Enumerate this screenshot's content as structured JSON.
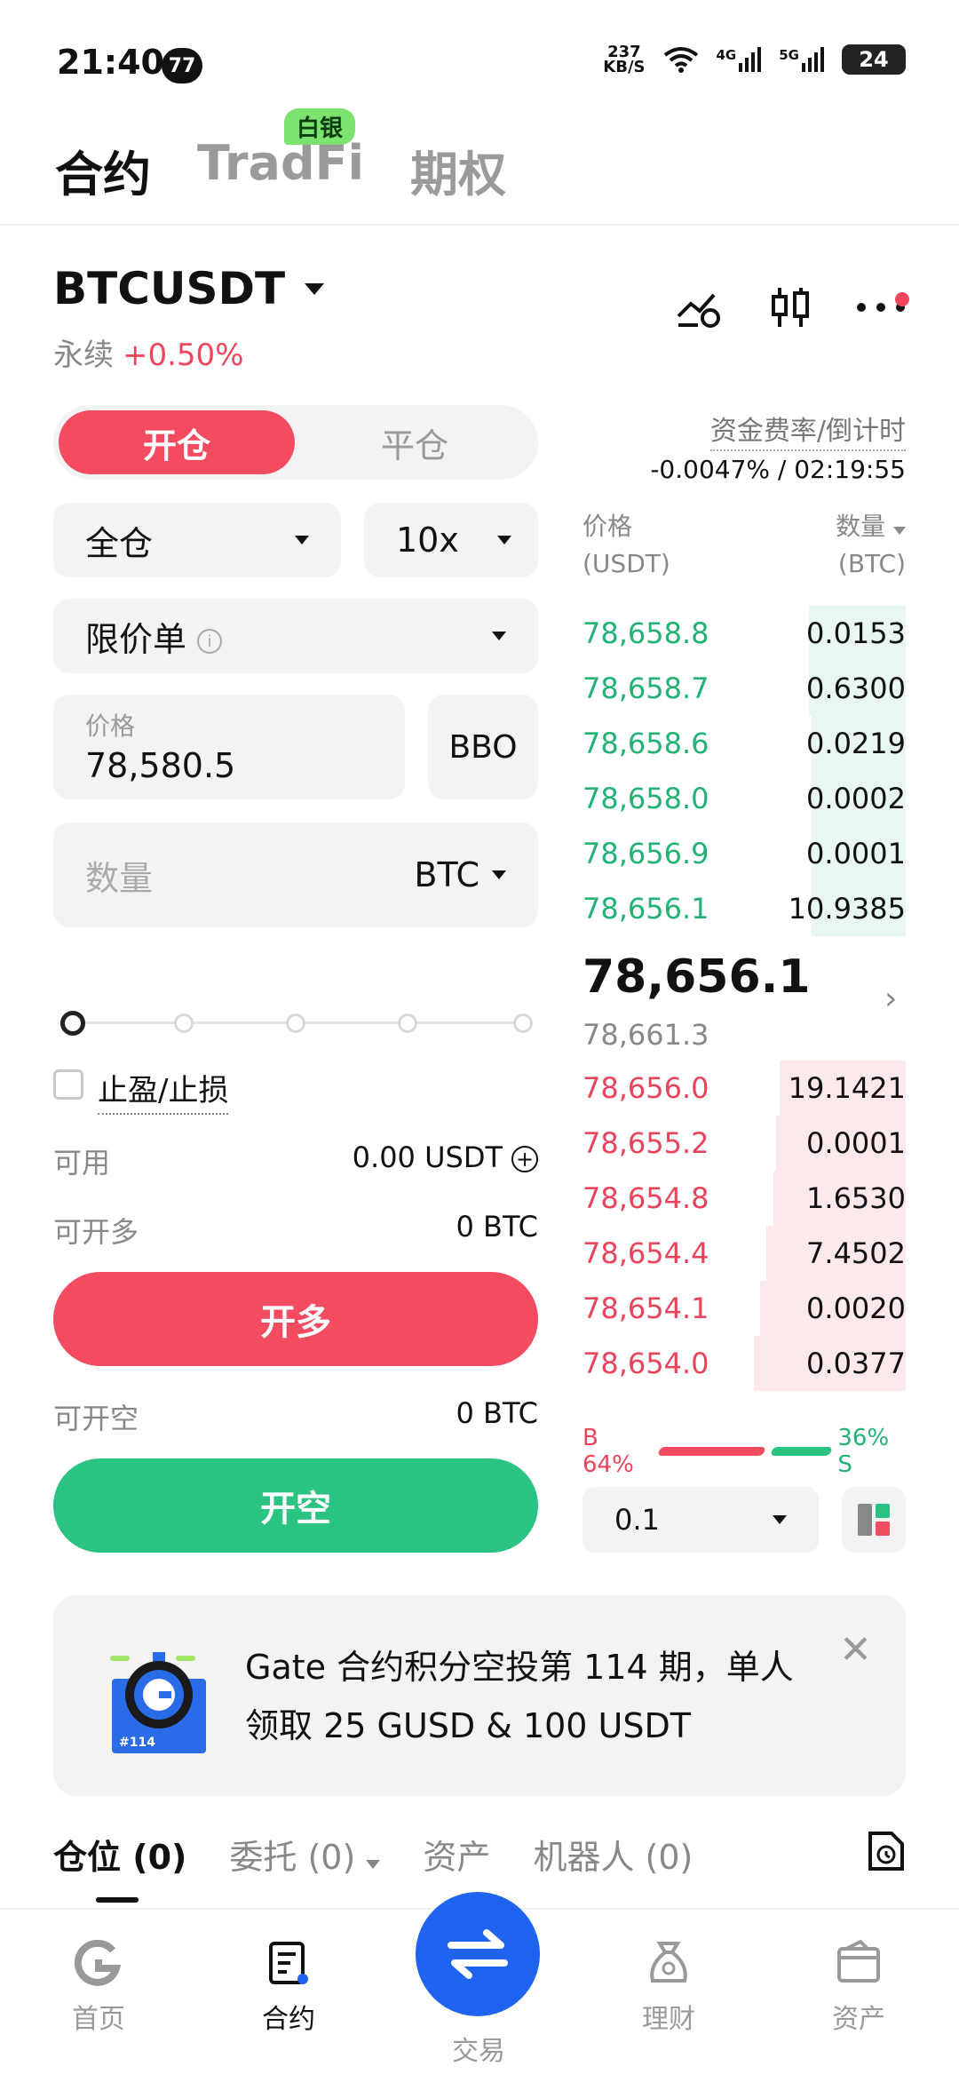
{
  "status_bar": {
    "time": "21:40",
    "badge": "77",
    "net_speed_value": "237",
    "net_speed_unit": "KB/S",
    "signal_1": "4G",
    "signal_2": "5G",
    "battery": "24"
  },
  "top_tabs": {
    "items": [
      "合约",
      "TradFi",
      "期权"
    ],
    "active": "合约",
    "tag": "白银"
  },
  "symbol": {
    "name": "BTCUSDT",
    "type": "永续",
    "change": "+0.50%"
  },
  "order_form": {
    "open_label": "开仓",
    "close_label": "平仓",
    "margin_mode": "全仓",
    "leverage": "10x",
    "order_type": "限价单",
    "price_label": "价格",
    "price_value": "78,580.5",
    "bbo_label": "BBO",
    "quantity_placeholder": "数量",
    "quantity_unit": "BTC",
    "slider_level": 0,
    "tp_sl_label": "止盈/止损",
    "available_label": "可用",
    "available_value": "0.00 USDT",
    "can_long_label": "可开多",
    "can_long_value": "0 BTC",
    "long_button": "开多",
    "can_short_label": "可开空",
    "can_short_value": "0 BTC",
    "short_button": "开空"
  },
  "orderbook": {
    "funding_label": "资金费率/倒计时",
    "funding_value": "-0.0047% / 02:19:55",
    "price_header": "价格",
    "price_unit": "(USDT)",
    "qty_header": "数量",
    "qty_unit": "(BTC)",
    "bids": [
      {
        "price": "78,658.8",
        "qty": "0.0153",
        "depth": 0.3
      },
      {
        "price": "78,658.7",
        "qty": "0.6300",
        "depth": 0.3
      },
      {
        "price": "78,658.6",
        "qty": "0.0219",
        "depth": 0.29
      },
      {
        "price": "78,658.0",
        "qty": "0.0002",
        "depth": 0.29
      },
      {
        "price": "78,656.9",
        "qty": "0.0001",
        "depth": 0.29
      },
      {
        "price": "78,656.1",
        "qty": "10.9385",
        "depth": 0.29
      }
    ],
    "last_price": "78,656.1",
    "mark_price": "78,661.3",
    "asks": [
      {
        "price": "78,656.0",
        "qty": "19.1421",
        "depth": 0.39
      },
      {
        "price": "78,655.2",
        "qty": "0.0001",
        "depth": 0.4
      },
      {
        "price": "78,654.8",
        "qty": "1.6530",
        "depth": 0.41
      },
      {
        "price": "78,654.4",
        "qty": "7.4502",
        "depth": 0.43
      },
      {
        "price": "78,654.1",
        "qty": "0.0020",
        "depth": 0.45
      },
      {
        "price": "78,654.0",
        "qty": "0.0377",
        "depth": 0.47
      }
    ],
    "buy_ratio": "B 64%",
    "sell_ratio": "36% S",
    "buy_pct": 64,
    "sell_pct": 36,
    "depth_value": "0.1"
  },
  "banner": {
    "text": "Gate 合约积分空投第 114 期，单人领取 25 GUSD & 100 USDT",
    "badge": "#114"
  },
  "position_tabs": [
    "仓位 (0)",
    "委托 (0)",
    "资产",
    "机器人 (0)"
  ],
  "bottom_nav": {
    "home": "首页",
    "futures": "合约",
    "trade": "交易",
    "earn": "理财",
    "assets": "资产"
  },
  "colors": {
    "red": "#f34b5f",
    "green": "#2bc381",
    "blue": "#1e64f0"
  }
}
